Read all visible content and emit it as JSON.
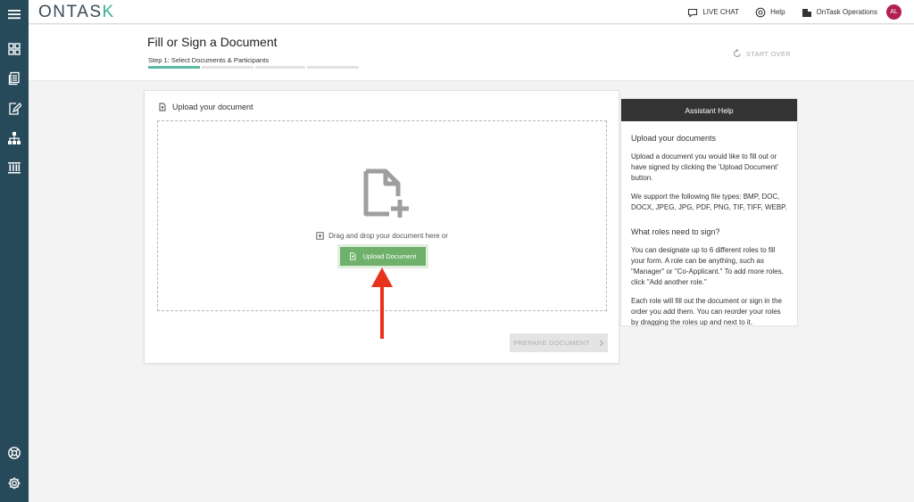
{
  "app": {
    "logo_text": "ONTAS",
    "logo_accent": "K"
  },
  "topbar": {
    "live_chat": "LIVE CHAT",
    "help": "Help",
    "org": "OnTask Operations",
    "avatar_initials": "AL"
  },
  "sidebar": {
    "items": [
      {
        "icon": "menu-icon"
      },
      {
        "icon": "dashboard-icon"
      },
      {
        "icon": "documents-icon"
      },
      {
        "icon": "sign-document-icon"
      },
      {
        "icon": "org-chart-icon"
      },
      {
        "icon": "building-icon"
      },
      {
        "icon": "support-icon"
      },
      {
        "icon": "gear-icon"
      }
    ]
  },
  "header": {
    "title": "Fill or Sign a Document",
    "step_label": "Step 1: Select Documents & Participants",
    "start_over": "START OVER",
    "steps_total": 4,
    "steps_done": 1
  },
  "upload_card": {
    "title": "Upload your document",
    "drag_text": "Drag and drop your document here or",
    "upload_button": "Upload Document",
    "prepare_button": "PREPARE DOCUMENT"
  },
  "assistant": {
    "title": "Assistant Help",
    "heading1": "Upload your documents",
    "p1": "Upload a document you would like to fill out or have signed by clicking the 'Upload Document' button.",
    "p2": "We support the following file types: BMP, DOC, DOCX, JPEG, JPG, PDF, PNG, TIF, TIFF, WEBP.",
    "heading2": "What roles need to sign?",
    "p3": "You can designate up to 6 different roles to fill your form. A role can be anything, such as \"Manager\" or \"Co-Applicant.\" To add more roles, click \"Add another role.\"",
    "p4": "Each role will fill out the document or sign in the order you add them. You can reorder your roles by dragging the roles up and next to it."
  },
  "colors": {
    "sidebar": "#264a5a",
    "accent": "#3bb08f",
    "upload_button": "#6fb06a",
    "avatar": "#b3204f",
    "arrow": "#e8321e"
  }
}
